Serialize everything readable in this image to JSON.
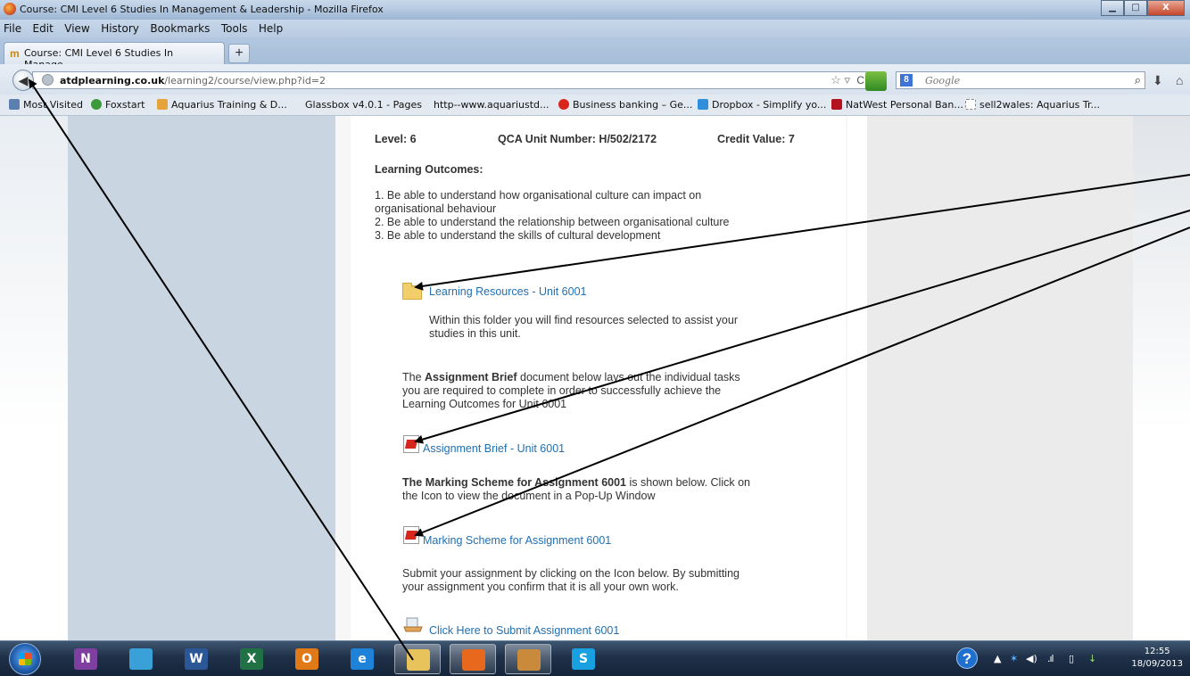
{
  "window": {
    "title": "Course: CMI Level 6 Studies In Management & Leadership - Mozilla Firefox",
    "minimize": "▁",
    "maximize": "□",
    "close": "X"
  },
  "menu": {
    "items": [
      "File",
      "Edit",
      "View",
      "History",
      "Bookmarks",
      "Tools",
      "Help"
    ]
  },
  "tabs": [
    {
      "label": "Course: CMI Level 6 Studies In Manage...",
      "icon": "moodle-icon"
    }
  ],
  "newtab_label": "+",
  "address": {
    "domain": "atdplearning.co.uk",
    "path": "/learning2/course/view.php?id=2"
  },
  "search": {
    "placeholder": "Google",
    "engine_glyph": "8"
  },
  "bookmarks": [
    "Most Visited",
    "Foxstart",
    "Aquarius Training & D...",
    "Glassbox v4.0.1 - Pages",
    "http--www.aquariustd...",
    "Business banking – Ge...",
    "Dropbox - Simplify yo...",
    "NatWest Personal Ban...",
    "sell2wales: Aquarius Tr..."
  ],
  "course": {
    "level": "Level: 6",
    "qca": "QCA Unit Number: H/502/2172",
    "credit": "Credit Value: 7",
    "outcomes_heading": "Learning Outcomes:",
    "outcome_1a": "1. Be able to understand how organisational culture can impact on",
    "outcome_1b": "organisational behaviour",
    "outcome_2": "2. Be able to understand the relationship between organisational culture",
    "outcome_3": "3. Be able to understand the skills of cultural development",
    "resources_link": "Learning Resources - Unit 6001",
    "resources_desc_1": "Within this folder you will find resources selected to assist your",
    "resources_desc_2": "studies in this unit.",
    "brief_intro_1a": "The ",
    "brief_intro_1b": "Assignment Brief",
    "brief_intro_1c": " document below lays out the individual tasks",
    "brief_intro_2": "you are required to complete in order to successfully achieve the",
    "brief_intro_3": "Learning Outcomes for Unit 6001",
    "brief_link": "Assignment Brief - Unit 6001",
    "marking_intro_1a": "The Marking Scheme for Assignment 6001",
    "marking_intro_1b": " is shown below. Click on",
    "marking_intro_2": "the Icon to view the document in a Pop-Up Window",
    "marking_link": "Marking Scheme for Assignment 6001",
    "submit_intro_1": "Submit your assignment by clicking on the Icon below. By submitting",
    "submit_intro_2": "your assignment you confirm that it is all your own work.",
    "submit_link": "Click Here to Submit Assignment 6001"
  },
  "taskbar": {
    "apps": [
      {
        "name": "onenote",
        "glyph": "N",
        "color": "#7f3fa0"
      },
      {
        "name": "sharepoint",
        "glyph": "",
        "color": "#3aa0d8"
      },
      {
        "name": "word",
        "glyph": "W",
        "color": "#2b5797"
      },
      {
        "name": "excel",
        "glyph": "X",
        "color": "#207245"
      },
      {
        "name": "outlook",
        "glyph": "O",
        "color": "#e07a16"
      },
      {
        "name": "internet-explorer",
        "glyph": "e",
        "color": "#1e82d8"
      },
      {
        "name": "file-explorer",
        "glyph": "",
        "color": "#e8c25a"
      },
      {
        "name": "firefox",
        "glyph": "",
        "color": "#e8681e"
      },
      {
        "name": "install",
        "glyph": "",
        "color": "#c98a3c"
      },
      {
        "name": "skype",
        "glyph": "S",
        "color": "#18a0e0"
      }
    ],
    "help": "?",
    "tray_arrow": "▲",
    "time": "12:55",
    "date": "18/09/2013"
  }
}
